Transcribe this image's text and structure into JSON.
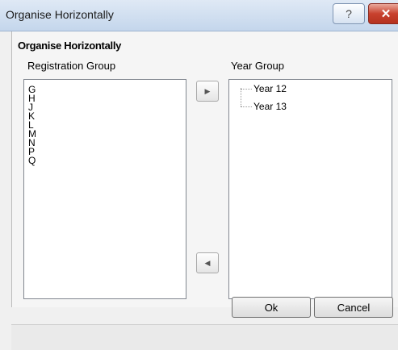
{
  "window": {
    "title": "Organise Horizontally",
    "help_glyph": "?",
    "close_glyph": "✕"
  },
  "dialog": {
    "heading": "Organise Horizontally",
    "left_label": "Registration Group",
    "right_label": "Year Group",
    "left_items": [
      "G",
      "H",
      "J",
      "K",
      "L",
      "M",
      "N",
      "P",
      "Q"
    ],
    "right_items": [
      "Year 12",
      "Year 13"
    ],
    "move_right_glyph": "▶",
    "move_left_glyph": "◀",
    "ok_label": "Ok",
    "cancel_label": "Cancel"
  }
}
